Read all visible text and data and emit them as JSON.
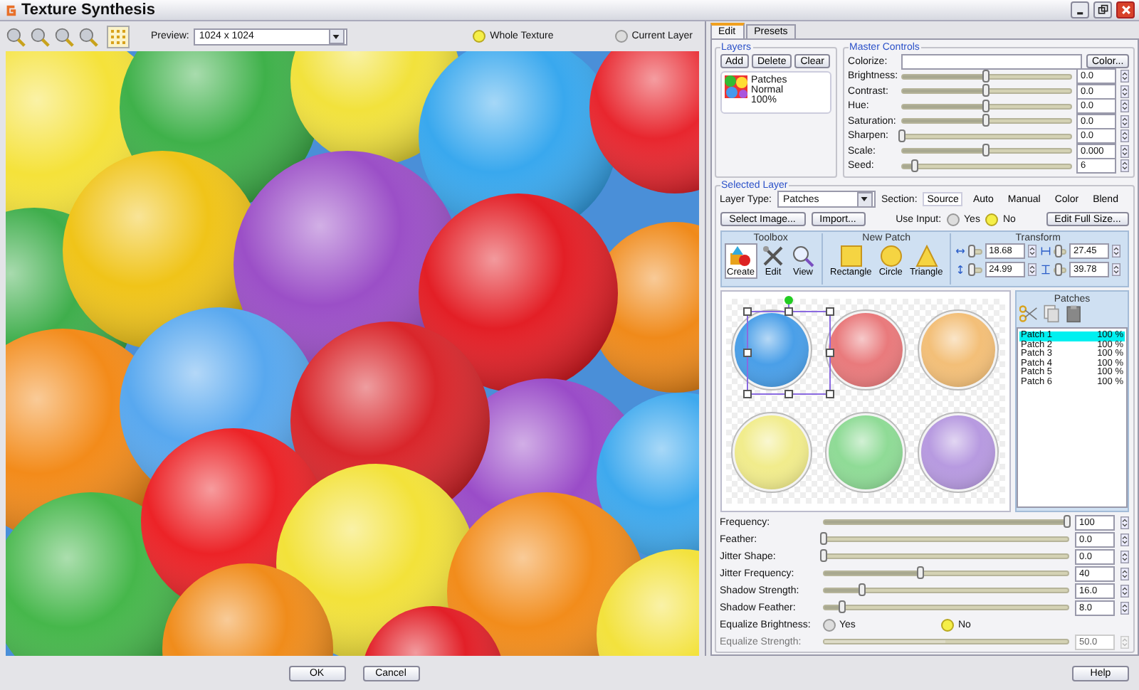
{
  "window": {
    "title": "Texture Synthesis"
  },
  "toolbar": {
    "preview_label": "Preview:",
    "preview_value": "1024 x 1024",
    "view_options": [
      {
        "label": "Whole Texture",
        "selected": true
      },
      {
        "label": "Current Layer",
        "selected": false
      }
    ]
  },
  "tabs": [
    {
      "label": "Edit",
      "selected": true
    },
    {
      "label": "Presets",
      "selected": false
    }
  ],
  "layers": {
    "title": "Layers",
    "buttons": [
      "Add",
      "Delete",
      "Clear"
    ],
    "items": [
      {
        "name": "Patches",
        "mode": "Normal",
        "opacity": "100%"
      }
    ]
  },
  "master_controls": {
    "title": "Master Controls",
    "colorize_label": "Colorize:",
    "color_button": "Color...",
    "sliders": [
      {
        "label": "Brightness:",
        "level": 0.5,
        "value": "0.0"
      },
      {
        "label": "Contrast:",
        "level": 0.5,
        "value": "0.0"
      },
      {
        "label": "Hue:",
        "level": 0.5,
        "value": "0.0"
      },
      {
        "label": "Saturation:",
        "level": 0.5,
        "value": "0.0"
      },
      {
        "label": "Sharpen:",
        "level": 0.0,
        "value": "0.0"
      },
      {
        "label": "Scale:",
        "level": 0.5,
        "value": "0.000"
      },
      {
        "label": "Seed:",
        "level": 0.08,
        "value": "6"
      }
    ]
  },
  "selected_layer": {
    "title": "Selected Layer",
    "layer_type_label": "Layer Type:",
    "layer_type": "Patches",
    "section_label": "Section:",
    "sections": [
      {
        "label": "Source",
        "selected": true
      },
      {
        "label": "Auto",
        "selected": false
      },
      {
        "label": "Manual",
        "selected": false
      },
      {
        "label": "Color",
        "selected": false
      },
      {
        "label": "Blend",
        "selected": false
      }
    ],
    "select_image": "Select Image...",
    "import": "Import...",
    "use_input": {
      "label": "Use Input:",
      "options": [
        {
          "label": "Yes",
          "selected": false
        },
        {
          "label": "No",
          "selected": true
        }
      ]
    },
    "edit_full_size": "Edit Full Size...",
    "toolbox": {
      "title": "Toolbox",
      "tools": [
        {
          "label": "Create",
          "selected": true
        },
        {
          "label": "Edit",
          "selected": false
        },
        {
          "label": "View",
          "selected": false
        }
      ]
    },
    "new_patch": {
      "title": "New Patch",
      "shapes": [
        "Rectangle",
        "Circle",
        "Triangle"
      ]
    },
    "transform": {
      "title": "Transform",
      "fields": [
        {
          "level": 0.3,
          "value": "18.68"
        },
        {
          "level": 0.5,
          "value": "27.45"
        },
        {
          "level": 0.3,
          "value": "24.99"
        },
        {
          "level": 0.5,
          "value": "39.78"
        }
      ]
    },
    "patches": {
      "title": "Patches",
      "items": [
        {
          "name": "Patch 1",
          "opacity": "100 %",
          "selected": true
        },
        {
          "name": "Patch 2",
          "opacity": "100 %",
          "selected": false
        },
        {
          "name": "Patch 3",
          "opacity": "100 %",
          "selected": false
        },
        {
          "name": "Patch 4",
          "opacity": "100 %",
          "selected": false
        },
        {
          "name": "Patch 5",
          "opacity": "100 %",
          "selected": false
        },
        {
          "name": "Patch 6",
          "opacity": "100 %",
          "selected": false
        }
      ]
    },
    "sliders": [
      {
        "label": "Frequency:",
        "level": 1.0,
        "value": "100"
      },
      {
        "label": "Feather:",
        "level": 0.0,
        "value": "0.0"
      },
      {
        "label": "Jitter Shape:",
        "level": 0.0,
        "value": "0.0"
      },
      {
        "label": "Jitter Frequency:",
        "level": 0.4,
        "value": "40"
      },
      {
        "label": "Shadow Strength:",
        "level": 0.16,
        "value": "16.0"
      },
      {
        "label": "Shadow Feather:",
        "level": 0.08,
        "value": "8.0"
      }
    ],
    "equalize_brightness": {
      "label": "Equalize Brightness:",
      "options": [
        {
          "label": "Yes",
          "selected": false
        },
        {
          "label": "No",
          "selected": true
        }
      ]
    },
    "equalize_strength": {
      "label": "Equalize Strength:",
      "level": 0.5,
      "value": "50.0",
      "disabled": true
    }
  },
  "footer": {
    "ok": "OK",
    "cancel": "Cancel",
    "help": "Help"
  }
}
